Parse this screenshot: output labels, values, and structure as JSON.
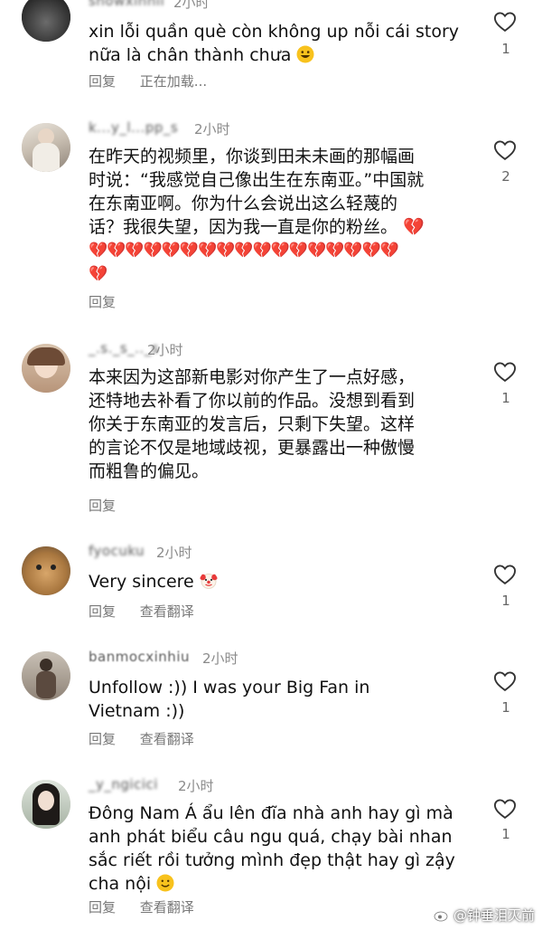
{
  "comments": [
    {
      "username": "showxinnii",
      "time": "2小时",
      "text": "xin lỗi quần què còn không up nỗi cái story\nnữa là chân thành chưa",
      "emoji": "grin",
      "actions": [
        "回复",
        "正在加载..."
      ],
      "likes": "1"
    },
    {
      "username": "k...y_l...pp_s",
      "time": "2小时",
      "text": "在昨天的视频里，你谈到田未未画的那幅画\n时说：“我感觉自己像出生在东南亚。”中国就\n在东南亚啊。你为什么会说出这么轻蔑的\n话？我很失望，因为我一直是你的粉丝。",
      "broken_hearts_line1": "💔",
      "broken_hearts_line2": "💔💔💔💔💔💔💔💔💔💔💔💔💔💔💔💔💔",
      "broken_hearts_line3": "💔",
      "actions": [
        "回复"
      ],
      "likes": "2"
    },
    {
      "username": "_.s._s_.._s",
      "time": "2小时",
      "text": "本来因为这部新电影对你产生了一点好感，\n还特地去补看了你以前的作品。没想到看到\n你关于东南亚的发言后，只剩下失望。这样\n的言论不仅是地域歧视，更暴露出一种傲慢\n而粗鲁的偏见。",
      "actions": [
        "回复"
      ],
      "likes": "1"
    },
    {
      "username": "fyocuku",
      "time": "2小时",
      "text": "Very sincere",
      "emoji": "clown",
      "actions": [
        "回复",
        "查看翻译"
      ],
      "likes": "1"
    },
    {
      "username": "banmocxinhiu",
      "time": "2小时",
      "text": "Unfollow :)) I was your Big Fan in\nVietnam :))",
      "actions": [
        "回复",
        "查看翻译"
      ],
      "likes": "1"
    },
    {
      "username": "_y_ngicici",
      "time": "2小时",
      "text": "Đông Nam Á ẩu lên đĩa nhà anh hay gì mà\nanh phát biểu câu ngu quá, chạy bài nhan\nsắc riết rồi tưởng mình đẹp thật hay gì zậy\ncha nội",
      "emoji": "smile",
      "actions": [
        "回复",
        "查看翻译"
      ],
      "likes": "1"
    }
  ],
  "watermark": "@钟垂泪灭前",
  "colors": {
    "broken_heart": "#e0245e",
    "meta": "#8a8a8a"
  }
}
